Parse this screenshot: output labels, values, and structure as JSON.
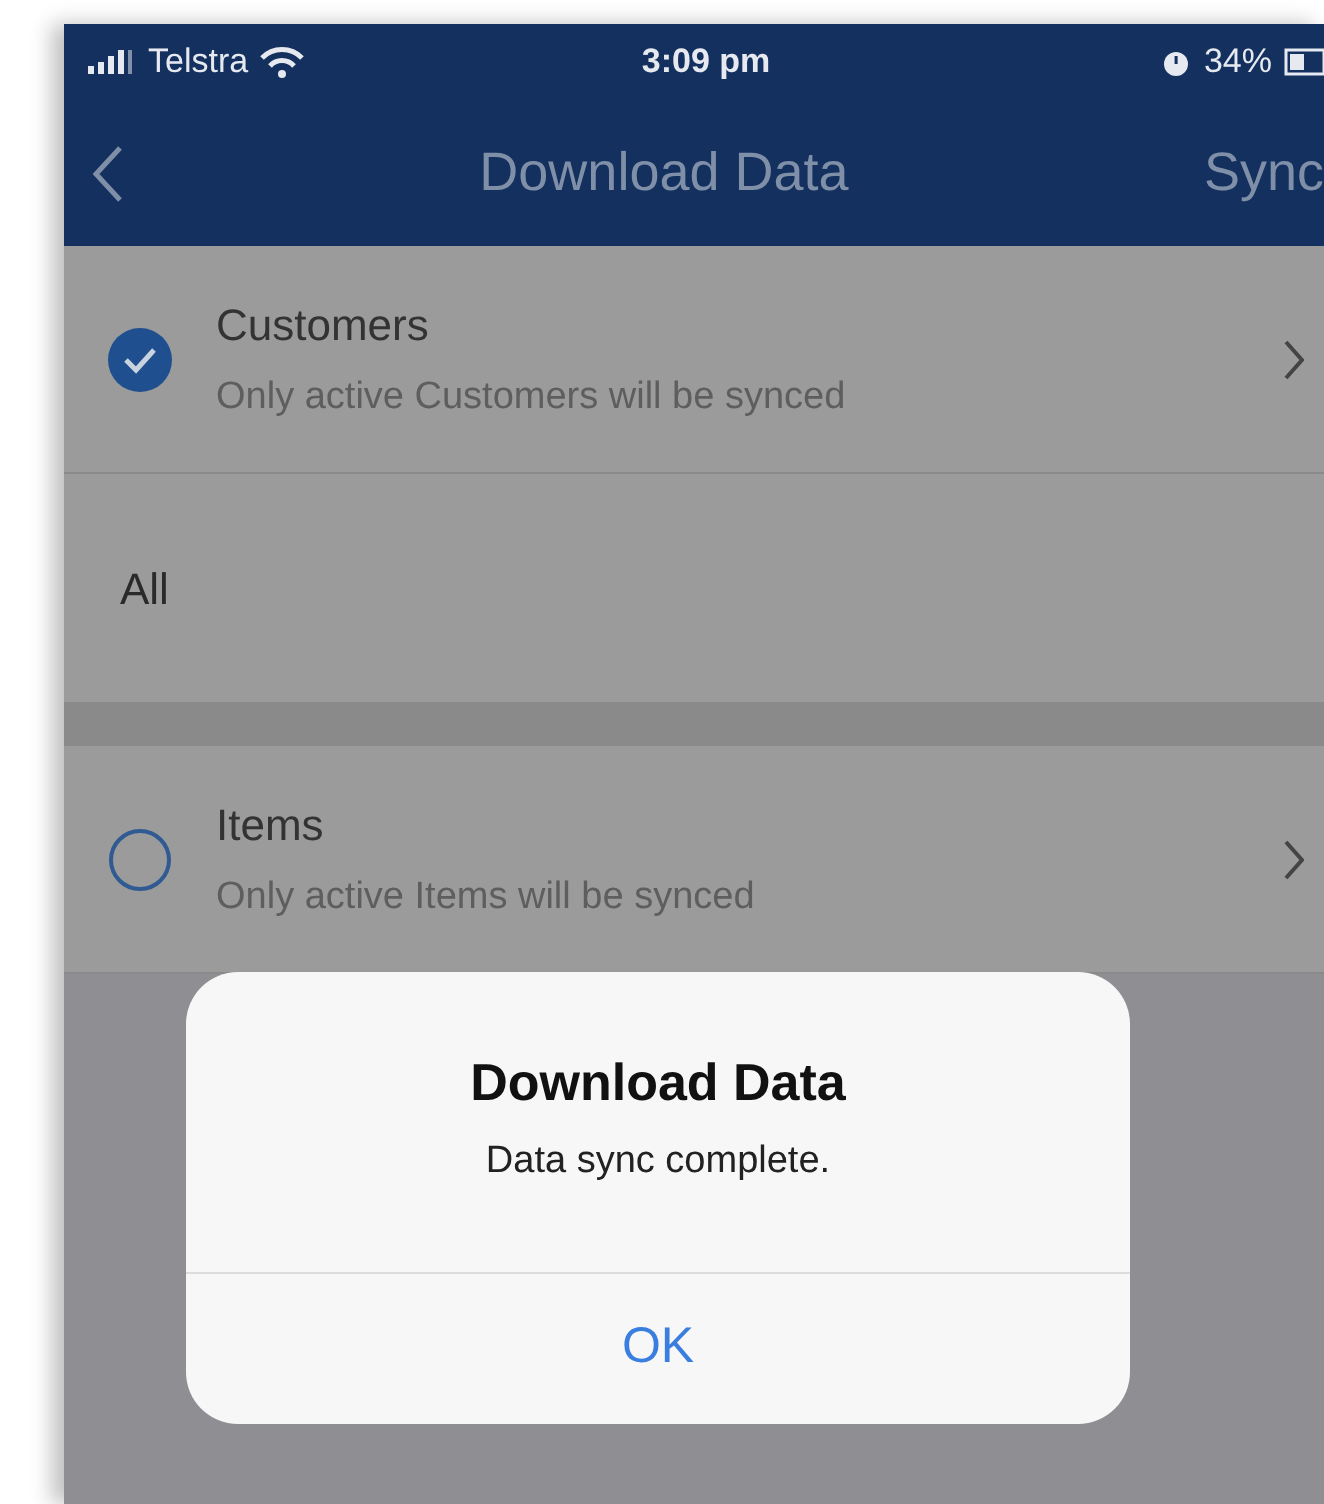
{
  "status_bar": {
    "carrier": "Telstra",
    "time": "3:09 pm",
    "battery": "34%"
  },
  "nav": {
    "title": "Download Data",
    "action": "Sync"
  },
  "rows": [
    {
      "kind": "option",
      "selected": true,
      "title": "Customers",
      "subtitle": "Only active Customers will be synced"
    },
    {
      "kind": "value",
      "label": "All"
    },
    {
      "kind": "spacer"
    },
    {
      "kind": "option",
      "selected": false,
      "title": "Items",
      "subtitle": "Only active Items will be synced"
    }
  ],
  "dialog": {
    "title": "Download Data",
    "message": "Data sync complete.",
    "button": "OK"
  }
}
